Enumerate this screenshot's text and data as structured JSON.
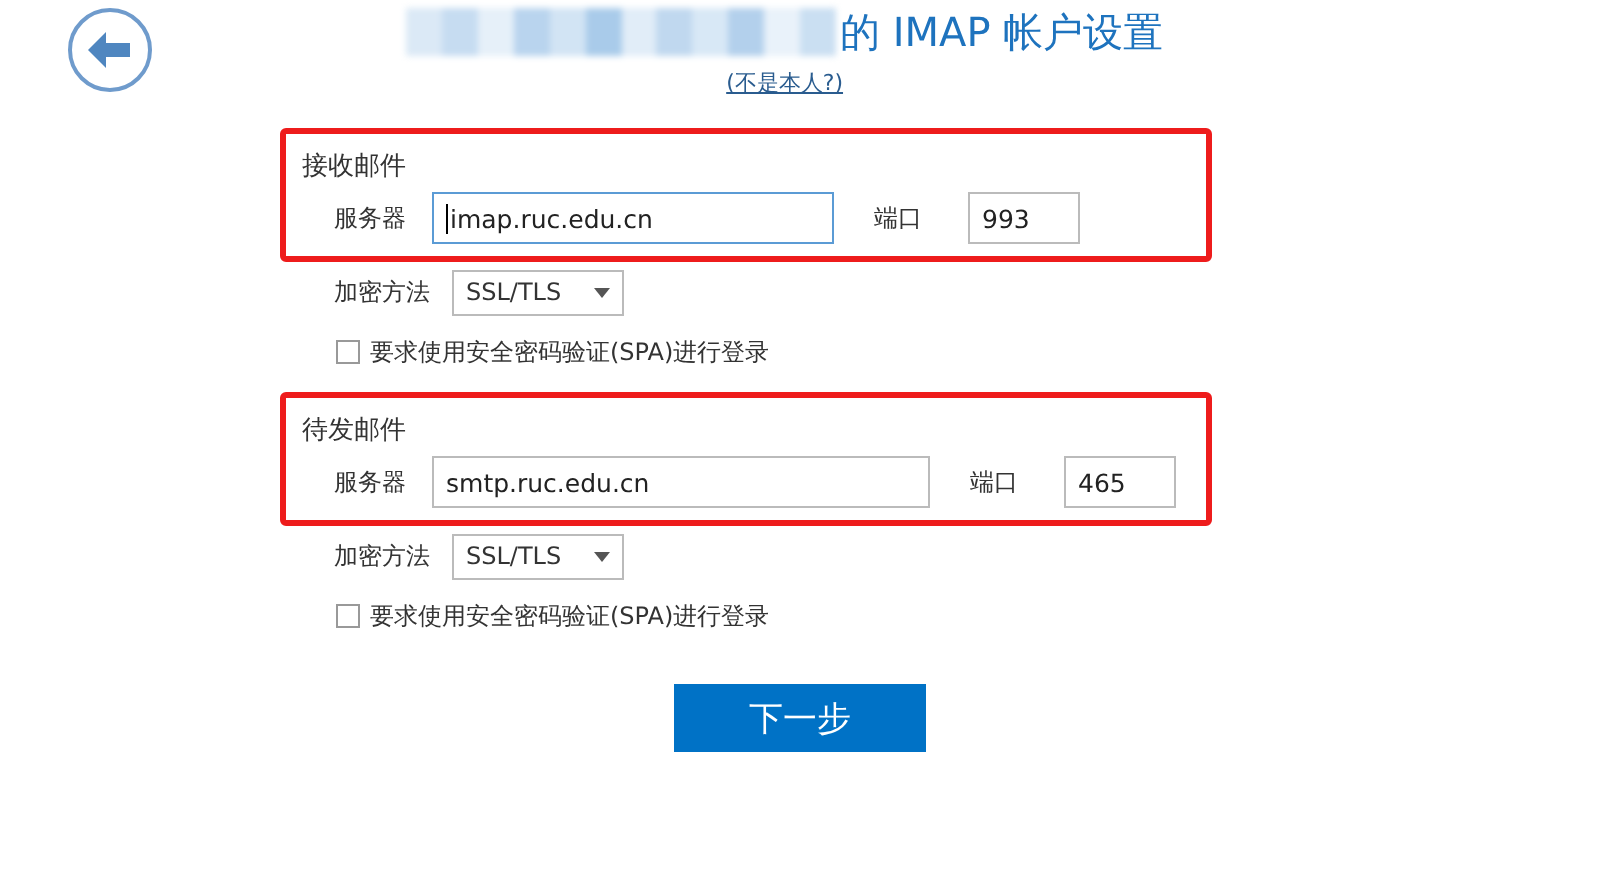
{
  "title": {
    "text": "的 IMAP 帐户设置",
    "redacted": true
  },
  "not_me_link": "(不是本人?)",
  "sections": [
    {
      "heading": "接收邮件",
      "highlighted": true,
      "server_label": "服务器",
      "server": "imap.ruc.edu.cn",
      "server_focused": true,
      "port_label": "端口",
      "port": "993",
      "encryption_label": "加密方法",
      "encryption": "SSL/TLS",
      "spa_label": "要求使用安全密码验证(SPA)进行登录",
      "spa_checked": false
    },
    {
      "heading": "待发邮件",
      "highlighted": true,
      "server_label": "服务器",
      "server": "smtp.ruc.edu.cn",
      "server_focused": false,
      "port_label": "端口",
      "port": "465",
      "encryption_label": "加密方法",
      "encryption": "SSL/TLS",
      "spa_label": "要求使用安全密码验证(SPA)进行登录",
      "spa_checked": false
    }
  ],
  "next_button": "下一步"
}
